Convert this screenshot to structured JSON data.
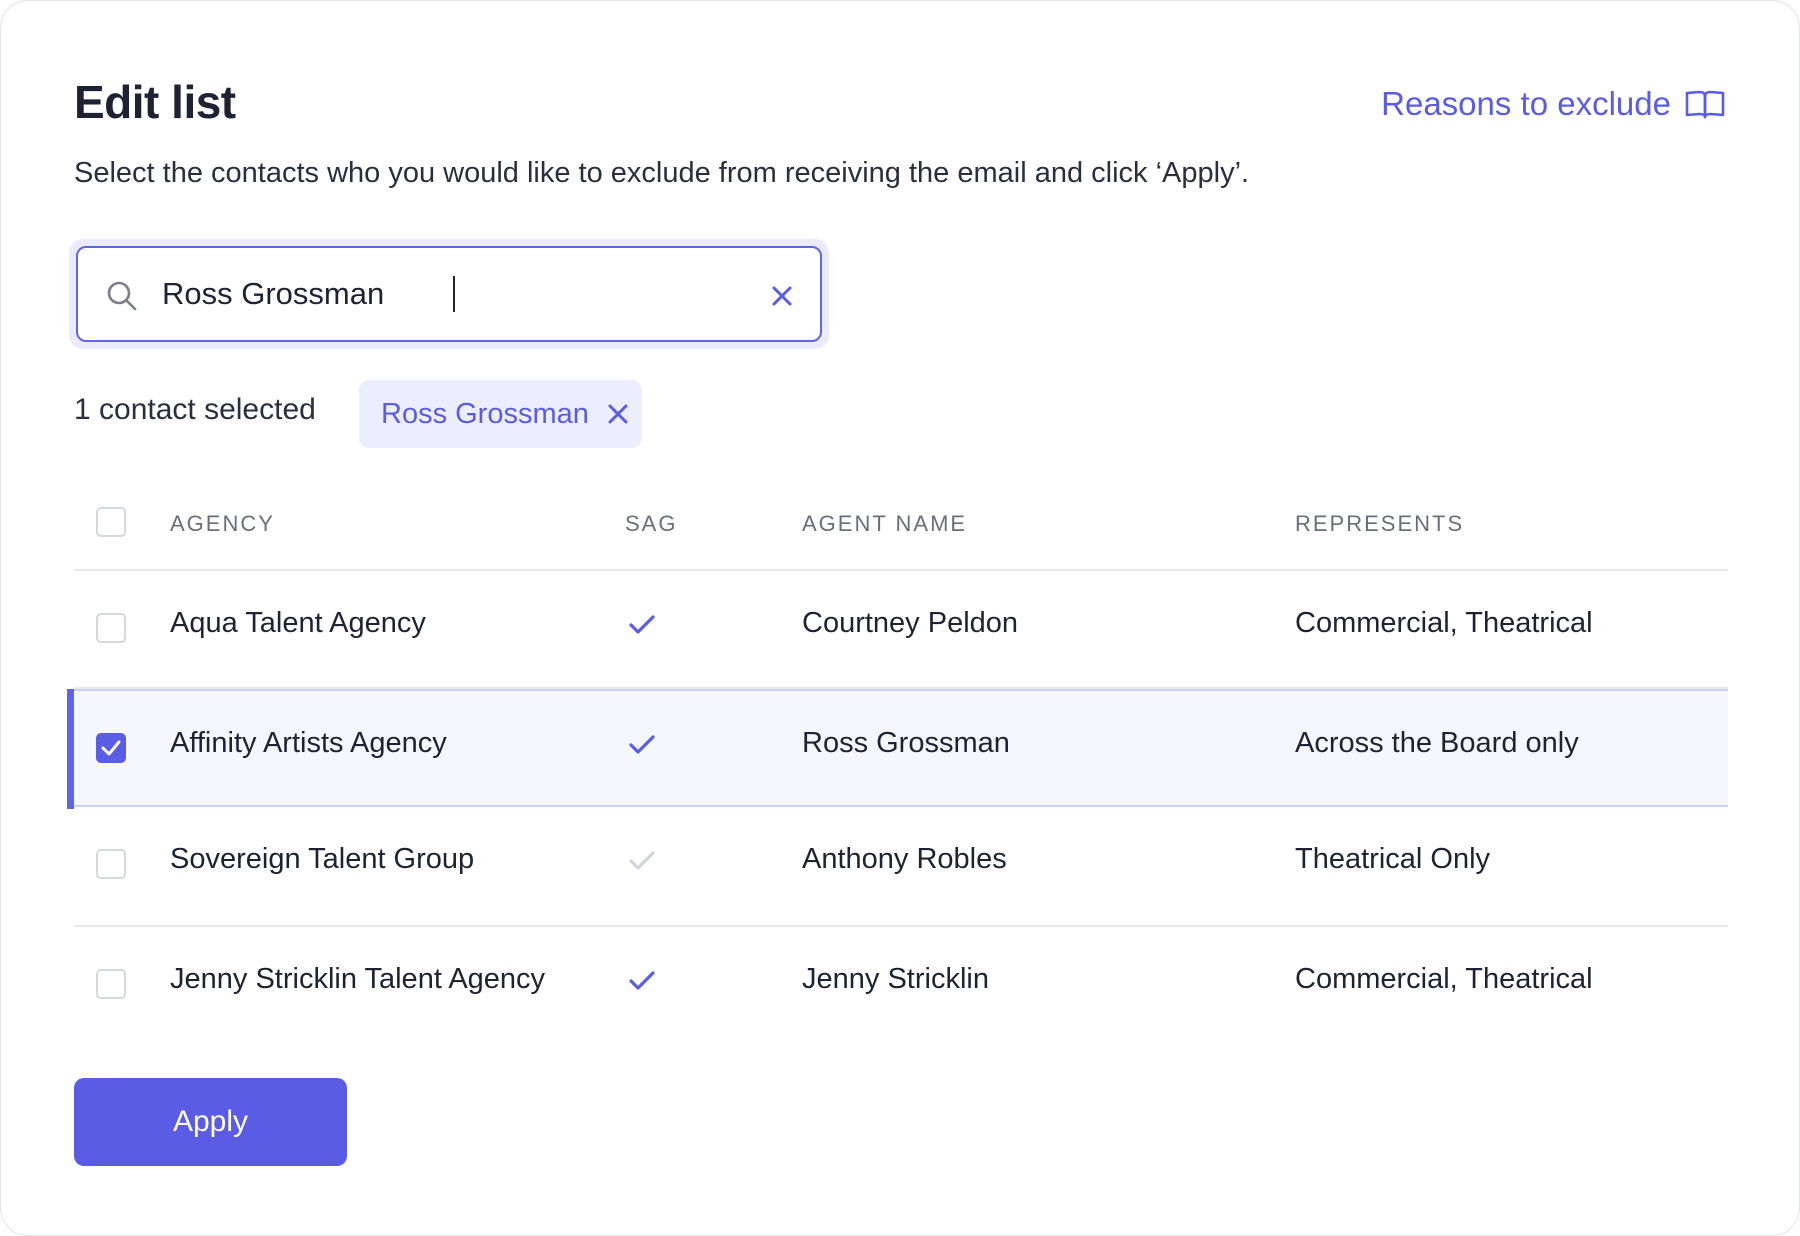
{
  "header": {
    "title": "Edit list",
    "reasons_link": "Reasons to exclude",
    "subtitle": "Select the contacts who you would like to exclude from receiving the email and click ‘Apply’."
  },
  "search": {
    "value": "Ross Grossman",
    "icon": "search-icon",
    "clear_icon": "close-icon"
  },
  "selection": {
    "count_text": "1 contact selected",
    "chips": [
      {
        "label": "Ross Grossman"
      }
    ]
  },
  "table": {
    "columns": [
      "AGENCY",
      "SAG",
      "AGENT NAME",
      "REPRESENTS"
    ],
    "rows": [
      {
        "agency": "Aqua Talent Agency",
        "sag": true,
        "agent": "Courtney Peldon",
        "represents": "Commercial, Theatrical",
        "selected": false
      },
      {
        "agency": "Affinity Artists Agency",
        "sag": true,
        "agent": "Ross Grossman",
        "represents": "Across the Board only",
        "selected": true
      },
      {
        "agency": "Sovereign Talent Group",
        "sag": false,
        "agent": "Anthony Robles",
        "represents": "Theatrical Only",
        "selected": false
      },
      {
        "agency": "Jenny Stricklin Talent Agency",
        "sag": true,
        "agent": "Jenny Stricklin",
        "represents": "Commercial, Theatrical",
        "selected": false
      }
    ]
  },
  "footer": {
    "apply_label": "Apply"
  },
  "colors": {
    "accent": "#5b5ce6",
    "text": "#1f2233",
    "muted": "#6b6e7c",
    "sag_inactive": "#d3d5dc",
    "selected_row_bg": "#f6f7fd"
  }
}
